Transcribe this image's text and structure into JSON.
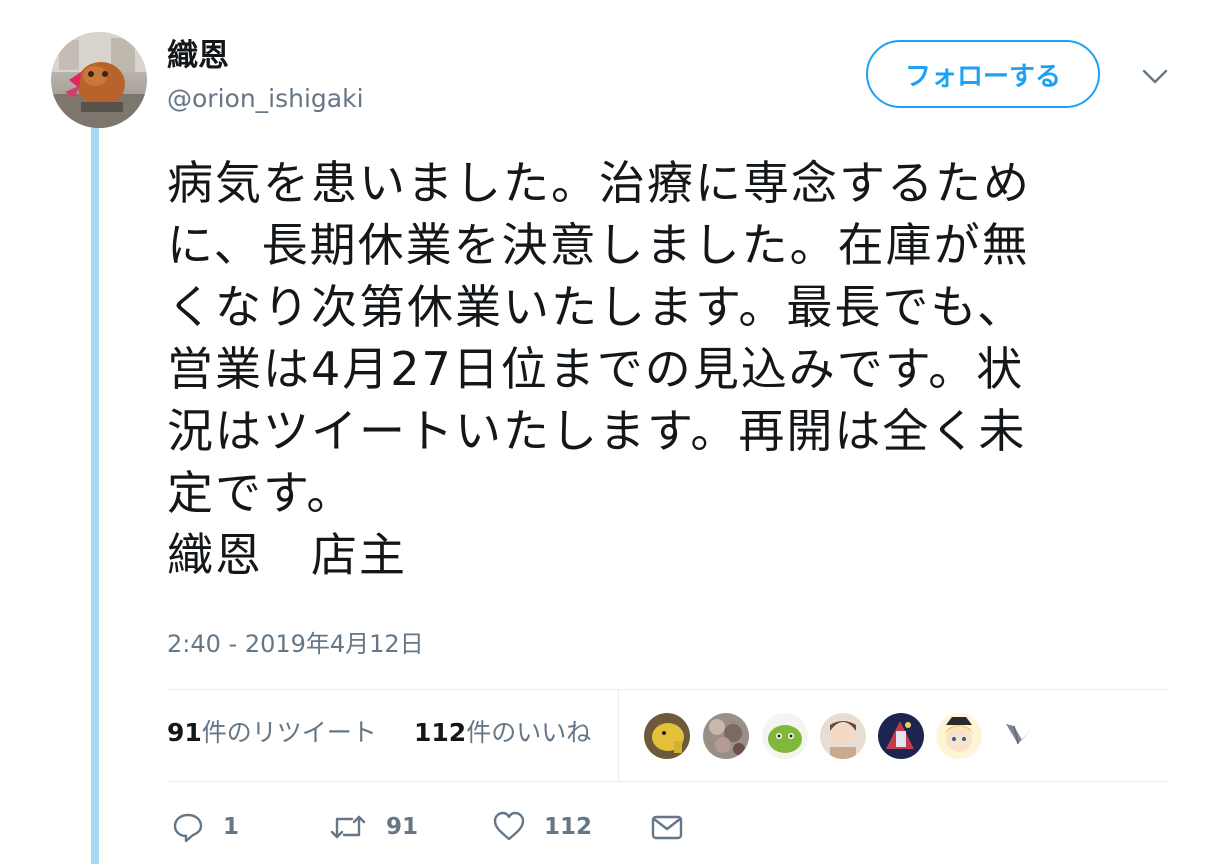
{
  "user": {
    "display_name": "織恩",
    "screen_name": "@orion_ishigaki"
  },
  "header": {
    "follow_label": "フォローする",
    "menu_icon": "chevron-down-icon"
  },
  "tweet": {
    "text": "病気を患いました。治療に専念するため\nに、長期休業を決意しました。在庫が無\nくなり次第休業いたします。最長でも、\n営業は4月27日位までの見込みです。状\n況はツイートいたします。再開は全く未\n定です。\n織恩　店主",
    "timestamp": "2:40 - 2019年4月12日"
  },
  "stats": {
    "retweets_count": "91",
    "retweets_label": "件のリツイート",
    "likes_count": "112",
    "likes_label": "件のいいね"
  },
  "actions": {
    "reply_count": "1",
    "retweet_count": "91",
    "like_count": "112"
  },
  "colors": {
    "accent": "#1da1f2",
    "thread_line": "#a8d8f4",
    "muted": "#657786"
  }
}
